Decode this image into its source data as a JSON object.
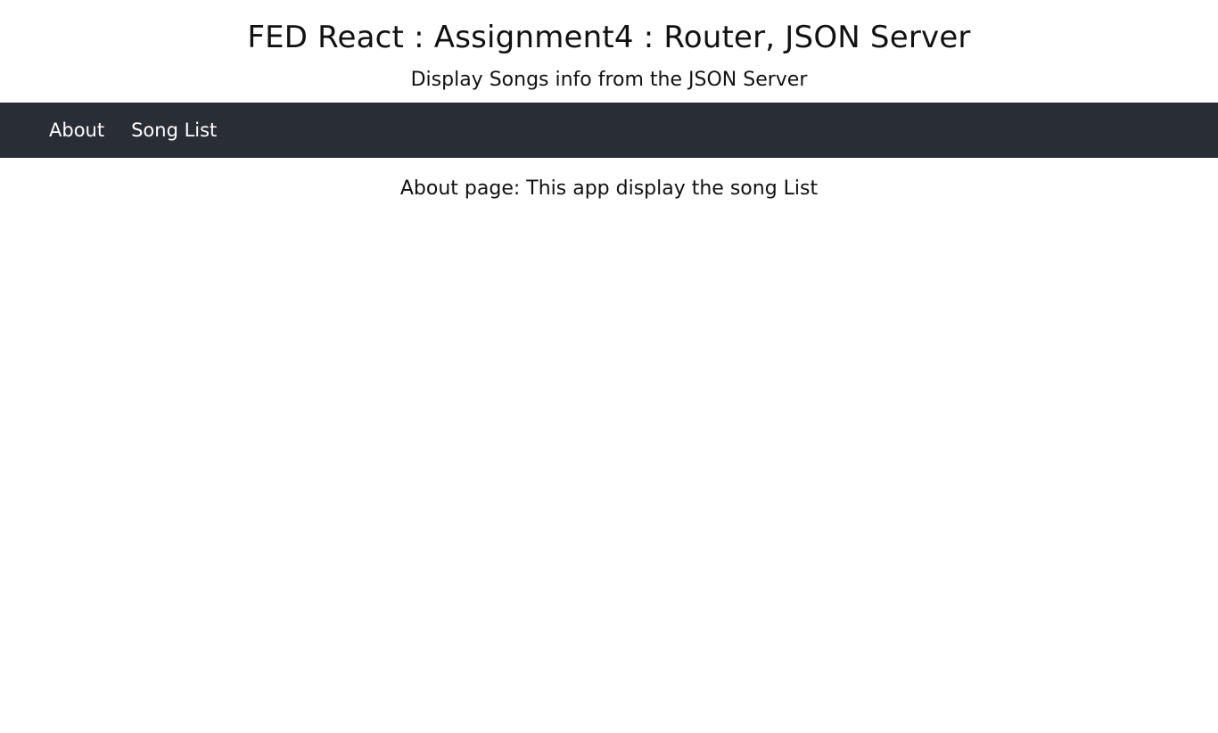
{
  "header": {
    "title": "FED React : Assignment4 : Router, JSON Server",
    "subtitle": "Display Songs info from the JSON Server"
  },
  "navbar": {
    "background_color": "#292d36",
    "links": [
      {
        "label": "About"
      },
      {
        "label": "Song List"
      }
    ]
  },
  "main": {
    "about_text": "About page: This app display the song List"
  }
}
